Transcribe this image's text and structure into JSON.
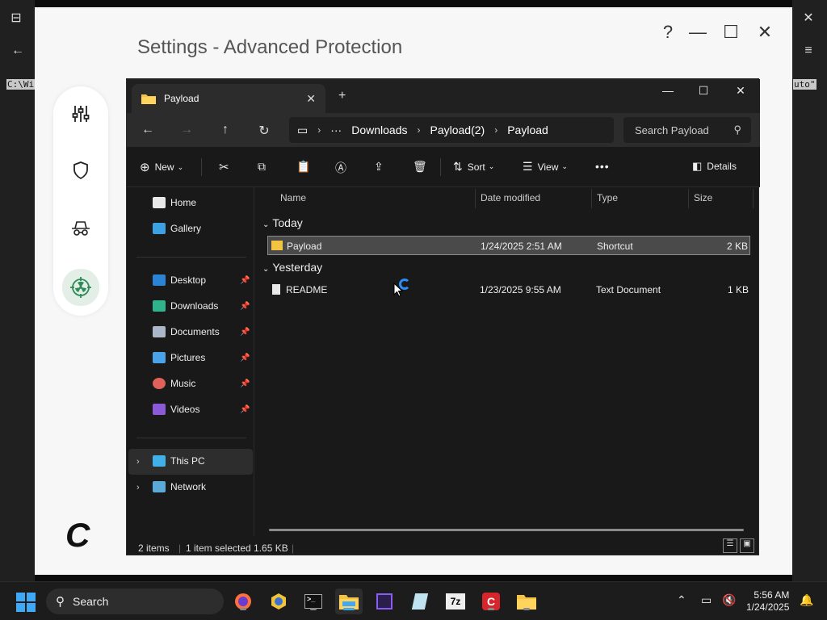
{
  "background": {
    "term_left": "C:\\Wi",
    "term_right": "uto\""
  },
  "settings": {
    "title": "Settings - Advanced Protection",
    "help": "?",
    "minimize": "—",
    "maximize": "☐",
    "close": "✕",
    "logo": "C",
    "rail": [
      "sliders-icon",
      "shield-icon",
      "spy-hat-icon",
      "radiation-target-icon"
    ]
  },
  "explorer": {
    "tab_label": "Payload",
    "breadcrumb": [
      "Downloads",
      "Payload(2)",
      "Payload"
    ],
    "search_placeholder": "Search Payload",
    "toolbar": {
      "new": "New",
      "sort": "Sort",
      "view": "View",
      "more": "•••",
      "details": "Details"
    },
    "nav": {
      "quick": [
        {
          "label": "Home"
        },
        {
          "label": "Gallery"
        }
      ],
      "pinned": [
        {
          "label": "Desktop"
        },
        {
          "label": "Downloads"
        },
        {
          "label": "Documents"
        },
        {
          "label": "Pictures"
        },
        {
          "label": "Music"
        },
        {
          "label": "Videos"
        }
      ],
      "drives": [
        {
          "label": "This PC"
        },
        {
          "label": "Network"
        }
      ]
    },
    "columns": [
      "Name",
      "Date modified",
      "Type",
      "Size"
    ],
    "groups": [
      {
        "label": "Today",
        "rows": [
          {
            "name": "Payload",
            "date": "1/24/2025 2:51 AM",
            "type": "Shortcut",
            "size": "2 KB"
          }
        ]
      },
      {
        "label": "Yesterday",
        "rows": [
          {
            "name": "README",
            "date": "1/23/2025 9:55 AM",
            "type": "Text Document",
            "size": "1 KB"
          }
        ]
      }
    ],
    "status": {
      "items": "2 items",
      "selected": "1 item selected  1.65 KB"
    }
  },
  "taskbar": {
    "search": "Search",
    "time": "5:56 AM",
    "date": "1/24/2025",
    "apps": [
      "firefox-icon",
      "chromium-icon",
      "terminal-icon",
      "file-explorer-icon",
      "cpu-icon",
      "notepad-icon",
      "7zip-icon",
      "ccleaner-icon",
      "folder-icon"
    ],
    "labels": {
      "zip": "7z",
      "cc": "C"
    }
  }
}
